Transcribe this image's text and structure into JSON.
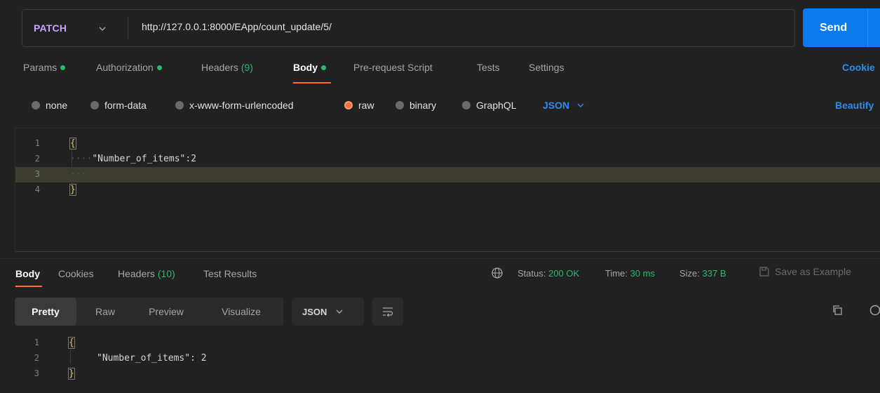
{
  "request": {
    "method": "PATCH",
    "url": "http://127.0.0.1:8000/EApp/count_update/5/",
    "send_label": "Send"
  },
  "request_tabs": {
    "params": "Params",
    "authorization": "Authorization",
    "headers": "Headers",
    "headers_count": "(9)",
    "body": "Body",
    "pre_request": "Pre-request Script",
    "tests": "Tests",
    "settings": "Settings",
    "cookies": "Cookie"
  },
  "body_types": {
    "none": "none",
    "form_data": "form-data",
    "urlencoded": "x-www-form-urlencoded",
    "raw": "raw",
    "binary": "binary",
    "graphql": "GraphQL",
    "format": "JSON",
    "beautify": "Beautify"
  },
  "request_body": {
    "line_numbers": [
      "1",
      "2",
      "3",
      "4"
    ],
    "open_brace": "{",
    "key": "\"Number_of_items\"",
    "colon": ":",
    "value": "2",
    "close_brace": "}",
    "indent": "····",
    "blank_indent": "···"
  },
  "response_tabs": {
    "body": "Body",
    "cookies": "Cookies",
    "headers": "Headers",
    "headers_count": "(10)",
    "test_results": "Test Results"
  },
  "response_status": {
    "status_label": "Status:",
    "status_value": "200 OK",
    "time_label": "Time:",
    "time_value": "30 ms",
    "size_label": "Size:",
    "size_value": "337 B",
    "save_example": "Save as Example"
  },
  "view_modes": {
    "pretty": "Pretty",
    "raw": "Raw",
    "preview": "Preview",
    "visualize": "Visualize",
    "format": "JSON"
  },
  "response_body": {
    "line_numbers": [
      "1",
      "2",
      "3"
    ],
    "open_brace": "{",
    "key": "\"Number_of_items\"",
    "colon": ":",
    "value": " 2",
    "close_brace": "}"
  },
  "colors": {
    "accent_orange": "#ff6c37",
    "send_blue": "#097bed",
    "status_green": "#2fb86e",
    "method_purple": "#c8a6ff"
  }
}
